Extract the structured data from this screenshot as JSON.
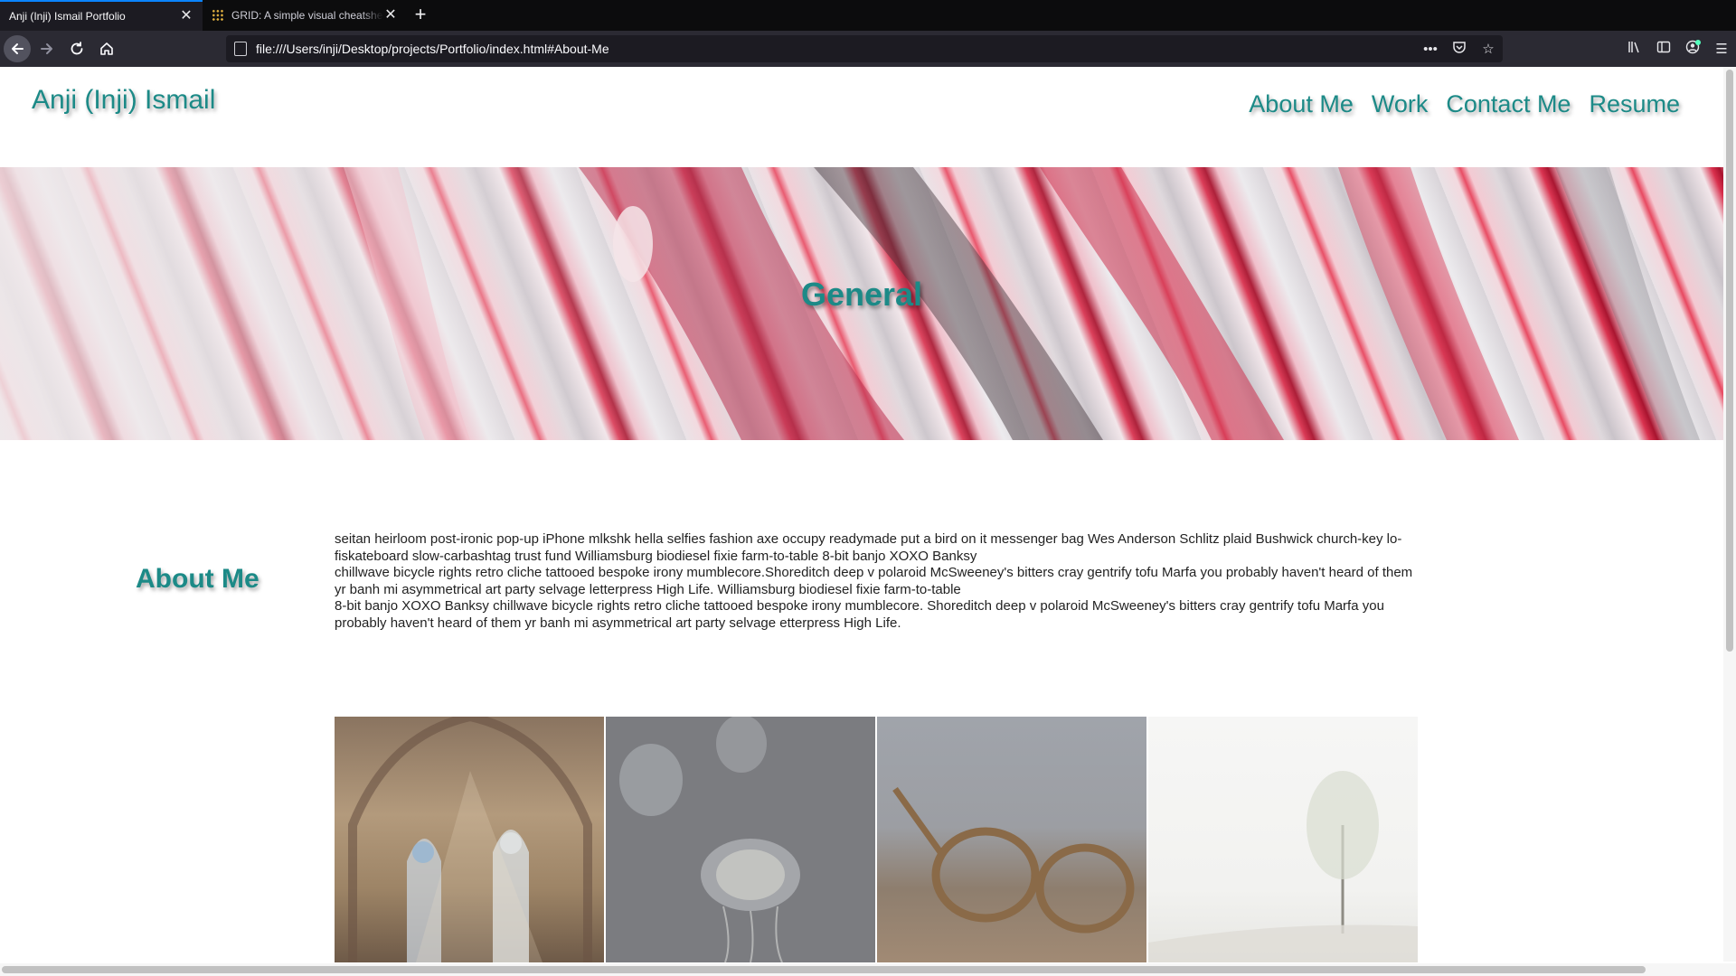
{
  "browser": {
    "tabs": [
      {
        "title": "Anji (Inji) Ismail Portfolio",
        "active": true
      },
      {
        "title": "GRID: A simple visual cheatsheet",
        "active": false
      }
    ],
    "url": "file:///Users/inji/Desktop/projects/Portfolio/index.html#About-Me",
    "icons": {
      "back": "back-arrow-icon",
      "forward": "forward-arrow-icon",
      "reload": "reload-icon",
      "home": "home-icon",
      "page_actions": "ellipsis-icon",
      "pocket": "pocket-icon",
      "bookmark": "star-icon",
      "library": "library-icon",
      "sidebar": "sidebar-icon",
      "account": "account-icon",
      "menu": "hamburger-menu-icon"
    }
  },
  "site": {
    "name": "Anji (Inji) Ismail",
    "nav": [
      "About Me",
      "Work",
      "Contact Me",
      "Resume"
    ],
    "accent_color": "#1c8a87"
  },
  "hero": {
    "title": "General"
  },
  "about": {
    "heading": "About Me",
    "paragraphs": [
      "seitan heirloom post-ironic pop-up iPhone mlkshk hella selfies fashion axe occupy readymade put a bird on it messenger bag Wes Anderson Schlitz plaid Bushwick church-key lo-fiskateboard slow-carbashtag trust fund Williamsburg biodiesel fixie farm-to-table 8-bit banjo XOXO Banksy",
      "chillwave bicycle rights retro cliche tattooed bespoke irony mumblecore.Shoreditch deep v polaroid McSweeney's bitters cray gentrify tofu Marfa you probably haven't heard of them yr banh mi asymmetrical art party selvage letterpress High Life. Williamsburg biodiesel fixie farm-to-table",
      "8-bit banjo XOXO Banksy chillwave bicycle rights retro cliche tattooed bespoke irony mumblecore. Shoreditch deep v polaroid McSweeney's bitters cray gentrify tofu Marfa you probably haven't heard of them yr banh mi asymmetrical art party selvage etterpress High Life."
    ]
  },
  "gallery": [
    "church-window-photo",
    "jellyfish-photo",
    "eyeglasses-photo",
    "lone-tree-photo"
  ]
}
